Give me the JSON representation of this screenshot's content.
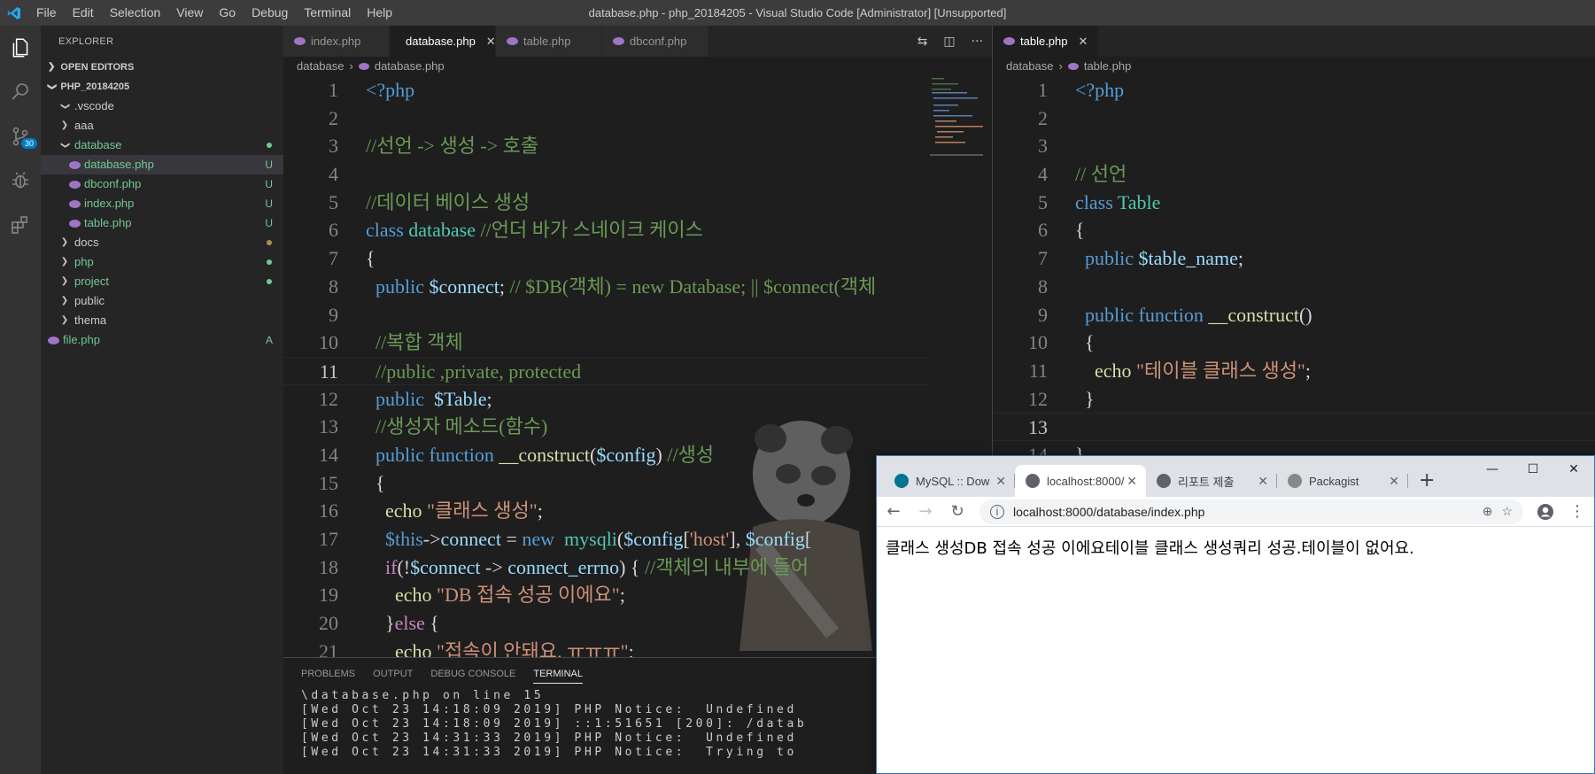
{
  "titlebar": {
    "menu": [
      "File",
      "Edit",
      "Selection",
      "View",
      "Go",
      "Debug",
      "Terminal",
      "Help"
    ],
    "title": "database.php - php_20184205 - Visual Studio Code [Administrator] [Unsupported]"
  },
  "activity": {
    "scm_badge": "30",
    "icons": [
      "files-icon",
      "search-icon",
      "source-control-icon",
      "debug-icon",
      "extensions-icon"
    ]
  },
  "sidebar": {
    "title": "EXPLORER",
    "open_editors": "OPEN EDITORS",
    "project": "PHP_20184205",
    "items": [
      {
        "label": ".vscode",
        "type": "folder",
        "open": true,
        "depth": 1
      },
      {
        "label": "aaa",
        "type": "folder",
        "open": false,
        "depth": 1
      },
      {
        "label": "database",
        "type": "folder",
        "open": true,
        "depth": 1,
        "dot": "#73c991",
        "color": "#73c991"
      },
      {
        "label": "database.php",
        "type": "file",
        "depth": 2,
        "status": "U",
        "color": "#73c991",
        "selected": true
      },
      {
        "label": "dbconf.php",
        "type": "file",
        "depth": 2,
        "status": "U",
        "color": "#73c991"
      },
      {
        "label": "index.php",
        "type": "file",
        "depth": 2,
        "status": "U",
        "color": "#73c991"
      },
      {
        "label": "table.php",
        "type": "file",
        "depth": 2,
        "status": "U",
        "color": "#73c991"
      },
      {
        "label": "docs",
        "type": "folder",
        "open": false,
        "depth": 1,
        "dot": "#b08a5a"
      },
      {
        "label": "php",
        "type": "folder",
        "open": false,
        "depth": 1,
        "dot": "#73c991",
        "color": "#73c991"
      },
      {
        "label": "project",
        "type": "folder",
        "open": false,
        "depth": 1,
        "dot": "#73c991",
        "color": "#73c991"
      },
      {
        "label": "public",
        "type": "folder",
        "open": false,
        "depth": 1
      },
      {
        "label": "thema",
        "type": "folder",
        "open": false,
        "depth": 1
      },
      {
        "label": "file.php",
        "type": "file",
        "depth": 0,
        "status": "A",
        "color": "#73c991"
      }
    ]
  },
  "editor1": {
    "tabs": [
      {
        "label": "index.php",
        "active": false
      },
      {
        "label": "database.php",
        "active": true
      },
      {
        "label": "table.php",
        "active": false
      },
      {
        "label": "dbconf.php",
        "active": false
      }
    ],
    "breadcrumb": [
      "database",
      "database.php"
    ],
    "current_line": 11,
    "lines": [
      {
        "n": "1",
        "html": "<span class='tg'>&lt;?php</span>"
      },
      {
        "n": "2",
        "html": ""
      },
      {
        "n": "3",
        "html": "<span class='c'>//선언 -&gt; 생성 -&gt; 호출</span>"
      },
      {
        "n": "4",
        "html": ""
      },
      {
        "n": "5",
        "html": "<span class='c'>//데이터 베이스 생성</span>"
      },
      {
        "n": "6",
        "html": "<span class='k'>class</span> <span class='t'>database</span> <span class='c'>//언더 바가 스네이크 케이스</span>"
      },
      {
        "n": "7",
        "html": "<span class='p'>{</span>"
      },
      {
        "n": "8",
        "html": "  <span class='k'>public</span> <span class='v'>$connect</span><span class='p'>;</span> <span class='c'>// $DB(객체) = new Database; || $connect(객체</span>"
      },
      {
        "n": "9",
        "html": ""
      },
      {
        "n": "10",
        "html": "  <span class='c'>//복합 객체</span>"
      },
      {
        "n": "11",
        "html": "  <span class='c'>//public ,private, protected</span>"
      },
      {
        "n": "12",
        "html": "  <span class='k'>public</span>  <span class='v'>$Table</span><span class='p'>;</span>"
      },
      {
        "n": "13",
        "html": "  <span class='c'>//생성자 메소드(함수)</span>"
      },
      {
        "n": "14",
        "html": "  <span class='k'>public</span> <span class='k'>function</span> <span class='f'>__construct</span><span class='p'>(</span><span class='v'>$config</span><span class='p'>)</span> <span class='c'>//생성</span>"
      },
      {
        "n": "15",
        "html": "  <span class='p'>{</span>"
      },
      {
        "n": "16",
        "html": "    <span class='f'>echo</span> <span class='s'>\"클래스 생성\"</span><span class='p'>;</span>"
      },
      {
        "n": "17",
        "html": "    <span class='k'>$this</span><span class='p'>-&gt;</span><span class='v'>connect</span> <span class='p'>=</span> <span class='k'>new</span>  <span class='t'>mysqli</span><span class='p'>(</span><span class='v'>$config</span><span class='p'>[</span><span class='s'>'host'</span><span class='p'>],</span> <span class='v'>$config</span><span class='p'>[</span>"
      },
      {
        "n": "18",
        "html": "    <span class='kw'>if</span><span class='p'>(!</span><span class='v'>$connect</span> <span class='p'>-&gt;</span> <span class='v'>connect_errno</span><span class='p'>) {</span> <span class='c'>//객체의 내부에 들어</span>"
      },
      {
        "n": "19",
        "html": "      <span class='f'>echo</span> <span class='s'>\"DB 접속 성공 이에요\"</span><span class='p'>;</span>"
      },
      {
        "n": "20",
        "html": "    <span class='p'>}</span><span class='kw'>else</span> <span class='p'>{</span>"
      },
      {
        "n": "21",
        "html": "      <span class='f'>echo</span> <span class='s'>\"접속이 안돼요. ㅠㅠㅠ\"</span><span class='p'>;</span>"
      }
    ]
  },
  "editor1_actions": [
    "compare-icon",
    "split-editor-icon",
    "more-icon"
  ],
  "editor2": {
    "tabs": [
      {
        "label": "table.php",
        "active": true
      }
    ],
    "breadcrumb": [
      "database",
      "table.php"
    ],
    "current_line": 13,
    "lines": [
      {
        "n": "1",
        "html": "<span class='tg'>&lt;?php</span>"
      },
      {
        "n": "2",
        "html": ""
      },
      {
        "n": "3",
        "html": ""
      },
      {
        "n": "4",
        "html": "<span class='c'>// 선언</span>"
      },
      {
        "n": "5",
        "html": "<span class='k'>class</span> <span class='t'>Table</span>"
      },
      {
        "n": "6",
        "html": "<span class='p'>{</span>"
      },
      {
        "n": "7",
        "html": "  <span class='k'>public</span> <span class='v'>$table_name</span><span class='p'>;</span>"
      },
      {
        "n": "8",
        "html": ""
      },
      {
        "n": "9",
        "html": "  <span class='k'>public</span> <span class='k'>function</span> <span class='f'>__construct</span><span class='p'>()</span>"
      },
      {
        "n": "10",
        "html": "  <span class='p'>{</span>"
      },
      {
        "n": "11",
        "html": "    <span class='f'>echo</span> <span class='s'>\"테이블 클래스 생성\"</span><span class='p'>;</span>"
      },
      {
        "n": "12",
        "html": "  <span class='p'>}</span>"
      },
      {
        "n": "13",
        "html": ""
      },
      {
        "n": "14",
        "html": "<span class='p'>}</span>"
      }
    ]
  },
  "panel": {
    "tabs": [
      "PROBLEMS",
      "OUTPUT",
      "DEBUG CONSOLE",
      "TERMINAL"
    ],
    "active_tab": "TERMINAL",
    "terminal_lines": [
      "\\database.php on line 15",
      "[Wed Oct 23 14:18:09 2019] PHP Notice:  Undefined",
      "[Wed Oct 23 14:18:09 2019] ::1:51651 [200]: /datab",
      "[Wed Oct 23 14:31:33 2019] PHP Notice:  Undefined",
      "[Wed Oct 23 14:31:33 2019] PHP Notice:  Trying to"
    ]
  },
  "browser": {
    "tabs": [
      {
        "label": "MySQL :: Dow",
        "fav": "#00758f",
        "active": false
      },
      {
        "label": "localhost:8000/",
        "fav": "#5f6368",
        "active": true
      },
      {
        "label": "리포트 제출",
        "fav": "#5f6368",
        "active": false
      },
      {
        "label": "Packagist",
        "fav": "#888888",
        "active": false
      }
    ],
    "new_tab": "+",
    "url": "localhost:8000/database/index.php",
    "content": "클래스 생성DB 접속 성공 이에요테이블 클래스 생성쿼리 성공.테이블이 없어요."
  }
}
